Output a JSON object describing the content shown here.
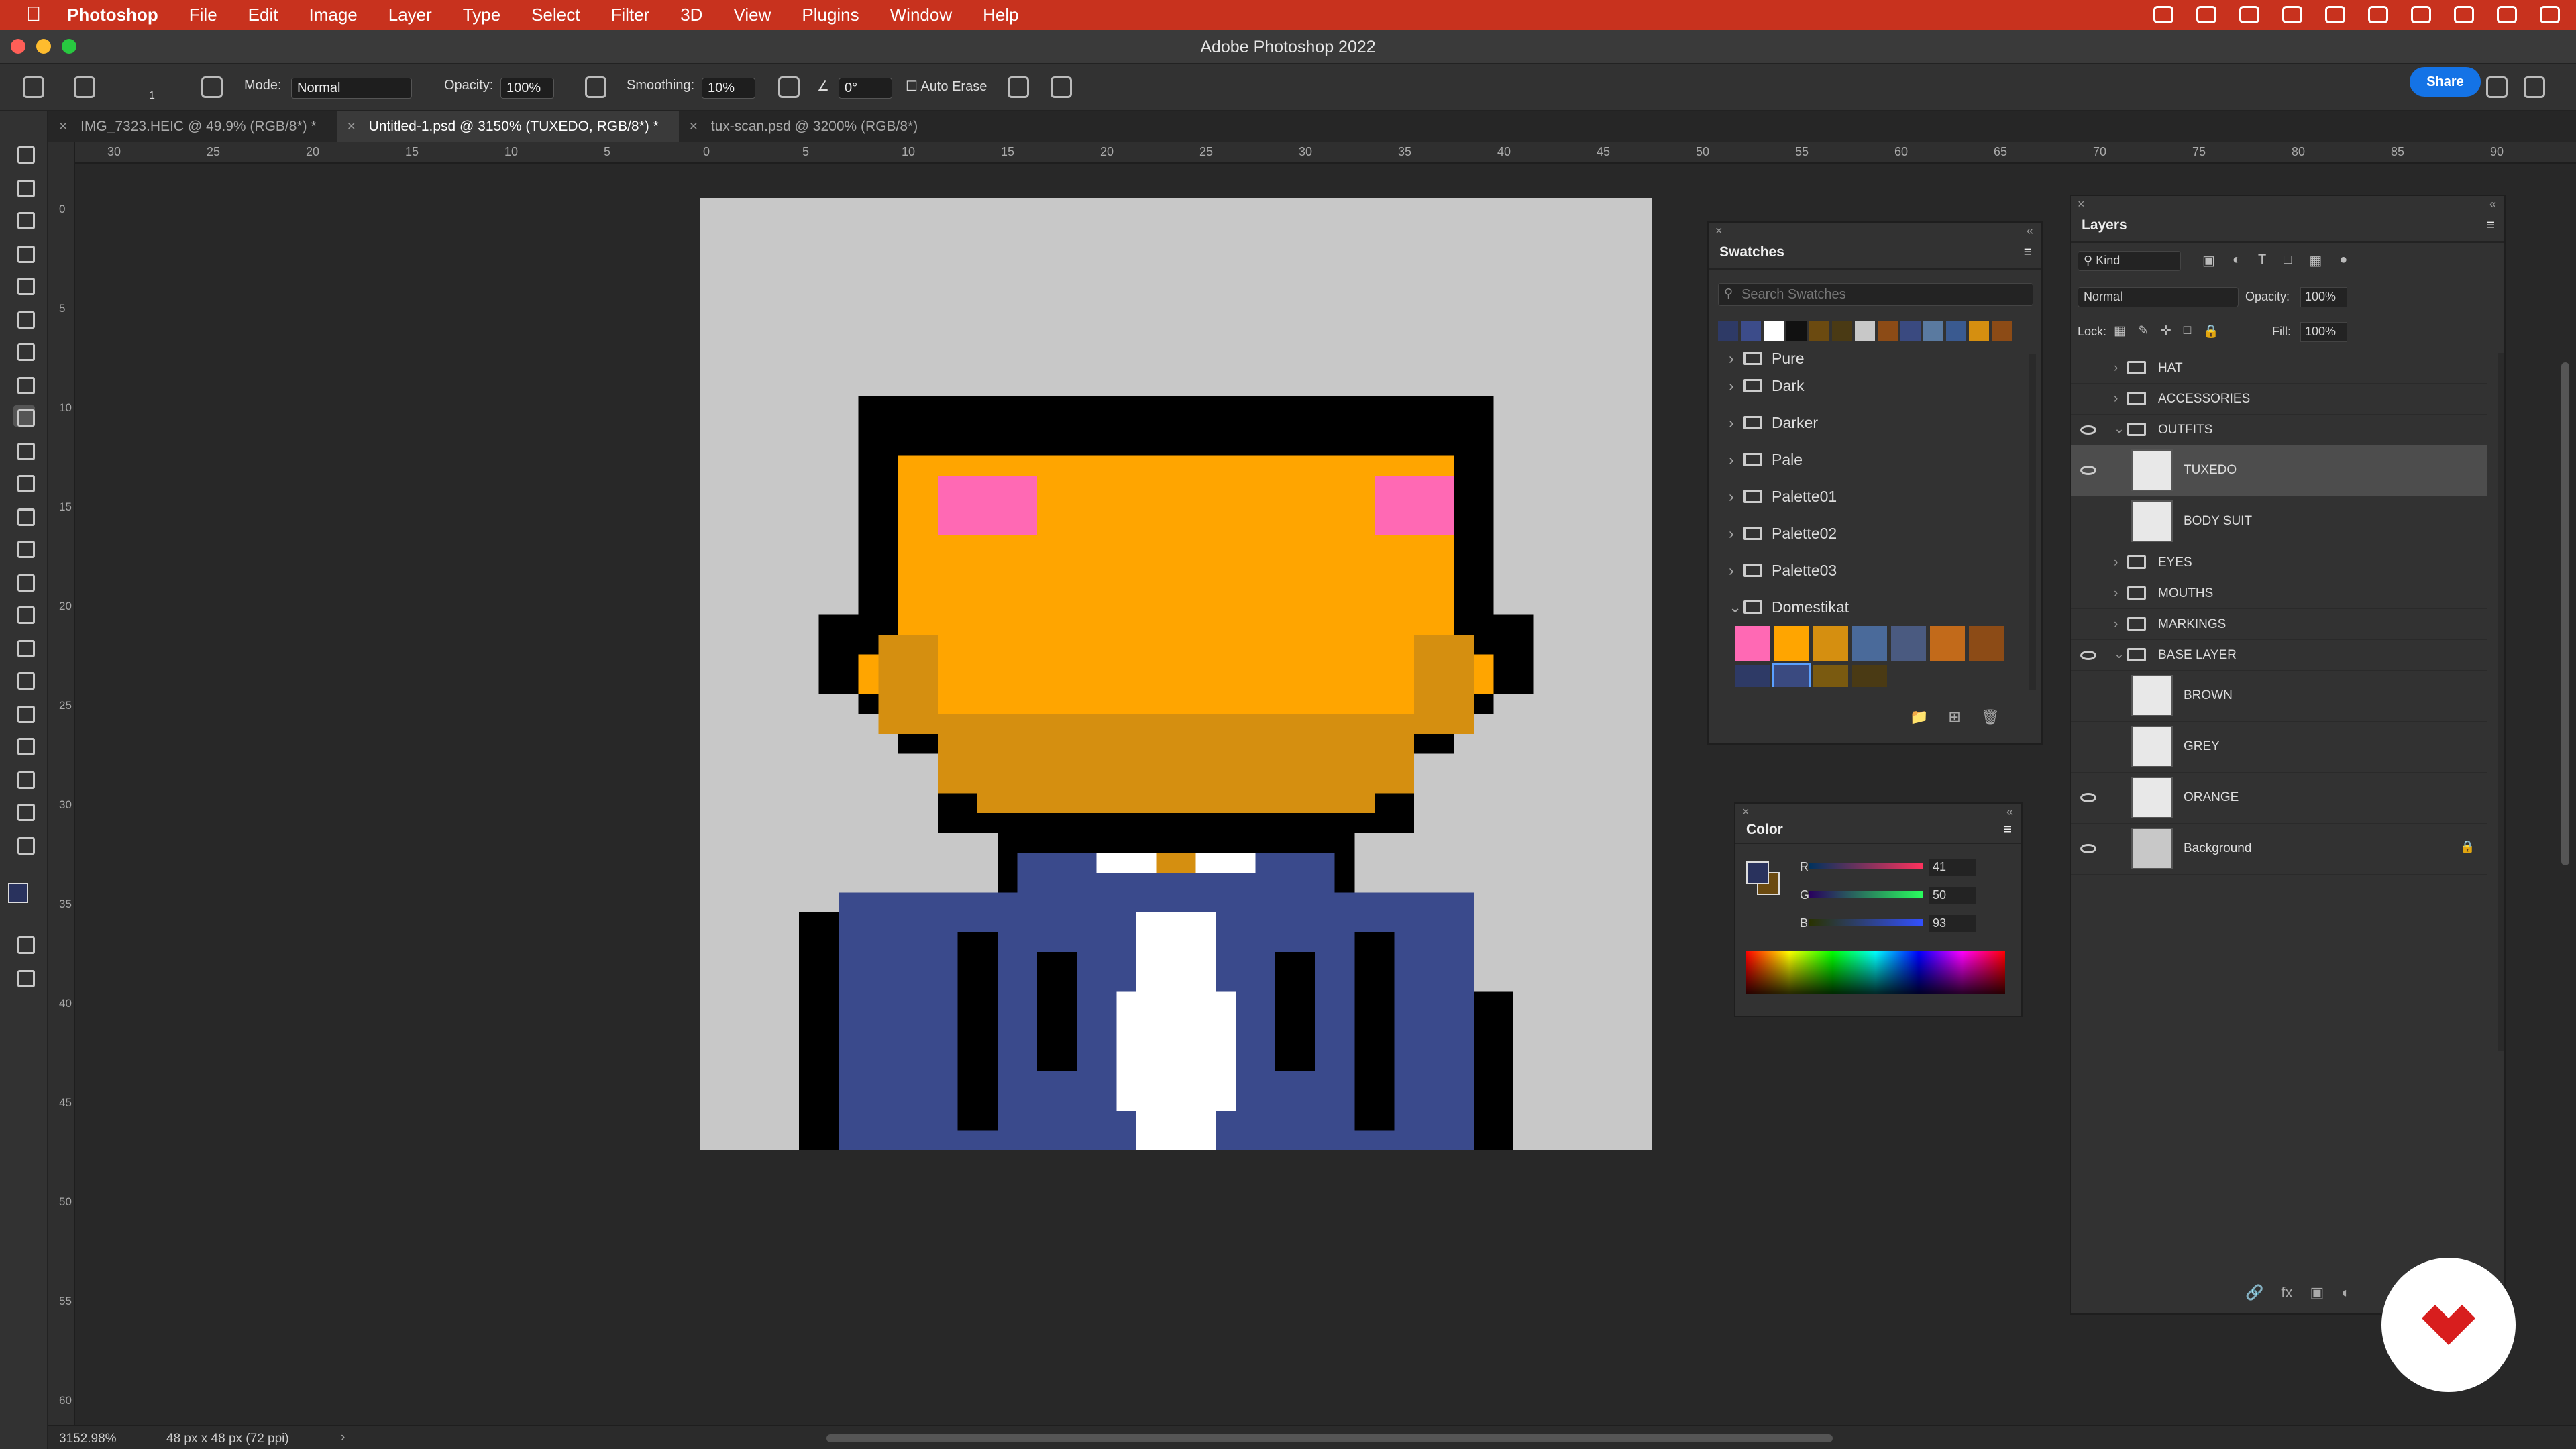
{
  "menubar": {
    "app_name": "Photoshop",
    "items": [
      "File",
      "Edit",
      "Image",
      "Layer",
      "Type",
      "Select",
      "Filter",
      "3D",
      "View",
      "Plugins",
      "Window",
      "Help"
    ],
    "accent": "#c8321e"
  },
  "window": {
    "title": "Adobe Photoshop 2022"
  },
  "options_bar": {
    "mode_label": "Mode:",
    "mode_value": "Normal",
    "opacity_label": "Opacity:",
    "opacity_value": "100%",
    "smoothing_label": "Smoothing:",
    "smoothing_value": "10%",
    "angle_value": "0°",
    "auto_erase_label": "Auto Erase",
    "brush_size": "1",
    "share_label": "Share"
  },
  "tabs": [
    {
      "label": "IMG_7323.HEIC @ 49.9% (RGB/8*) *",
      "active": false
    },
    {
      "label": "Untitled-1.psd @ 3150% (TUXEDO, RGB/8*) *",
      "active": true
    },
    {
      "label": "tux-scan.psd @ 3200% (RGB/8*)",
      "active": false
    }
  ],
  "ruler_h_ticks": [
    "30",
    "25",
    "20",
    "15",
    "10",
    "5",
    "0",
    "5",
    "10",
    "15",
    "20",
    "25",
    "30",
    "35",
    "40",
    "45",
    "50",
    "55",
    "60",
    "65",
    "70",
    "75",
    "80",
    "85",
    "90"
  ],
  "ruler_v_ticks": [
    "0",
    "5",
    "10",
    "15",
    "20",
    "25",
    "30",
    "35",
    "40",
    "45",
    "50",
    "55",
    "60"
  ],
  "swatches": {
    "title": "Swatches",
    "search_placeholder": "Search Swatches",
    "recent_colors": [
      "#2e3a66",
      "#3c4c8a",
      "#ffffff",
      "#111111",
      "#6b4a10",
      "#4a3a14",
      "#c8c8c8",
      "#8c4b16",
      "#3a4a80",
      "#5a7aa0",
      "#3a5a90",
      "#d58f10",
      "#8c4b16"
    ],
    "groups": [
      {
        "name": "Pure",
        "open": false
      },
      {
        "name": "Dark",
        "open": false
      },
      {
        "name": "Darker",
        "open": false
      },
      {
        "name": "Pale",
        "open": false
      },
      {
        "name": "Palette01",
        "open": false
      },
      {
        "name": "Palette02",
        "open": false
      },
      {
        "name": "Palette03",
        "open": false
      },
      {
        "name": "Domestikat",
        "open": true
      }
    ],
    "domestikat_colors": [
      "#ff69b4",
      "#ffa500",
      "#d58f10",
      "#4a6a9a",
      "#4a5a80",
      "#c26a1a",
      "#8c4b16",
      "#2e3a66",
      "#3a4a80",
      "#7a5a10",
      "#4a3a14"
    ]
  },
  "color_panel": {
    "title": "Color",
    "r_label": "R",
    "r_value": "41",
    "g_label": "G",
    "g_value": "50",
    "b_label": "B",
    "b_value": "93",
    "foreground": "#29325d",
    "background": "#6b4a10"
  },
  "layers": {
    "title": "Layers",
    "filter_kind": "Kind",
    "blend_mode": "Normal",
    "opacity_label": "Opacity:",
    "opacity_value": "100%",
    "lock_label": "Lock:",
    "fill_label": "Fill:",
    "fill_value": "100%",
    "items": [
      {
        "name": "HAT",
        "type": "group",
        "visible": false,
        "expanded": false,
        "indent": 0
      },
      {
        "name": "ACCESSORIES",
        "type": "group",
        "visible": false,
        "expanded": false,
        "indent": 0
      },
      {
        "name": "OUTFITS",
        "type": "group",
        "visible": true,
        "expanded": true,
        "indent": 0
      },
      {
        "name": "TUXEDO",
        "type": "layer",
        "visible": true,
        "selected": true,
        "indent": 1
      },
      {
        "name": "BODY SUIT",
        "type": "layer",
        "visible": false,
        "indent": 1
      },
      {
        "name": "EYES",
        "type": "group",
        "visible": false,
        "expanded": false,
        "indent": 0
      },
      {
        "name": "MOUTHS",
        "type": "group",
        "visible": false,
        "expanded": false,
        "indent": 0
      },
      {
        "name": "MARKINGS",
        "type": "group",
        "visible": false,
        "expanded": false,
        "indent": 0
      },
      {
        "name": "BASE LAYER",
        "type": "group",
        "visible": true,
        "expanded": true,
        "indent": 0
      },
      {
        "name": "BROWN",
        "type": "layer",
        "visible": false,
        "indent": 1
      },
      {
        "name": "GREY",
        "type": "layer",
        "visible": false,
        "indent": 1
      },
      {
        "name": "ORANGE",
        "type": "layer",
        "visible": true,
        "indent": 1
      },
      {
        "name": "Background",
        "type": "background",
        "visible": true,
        "locked": true,
        "indent": 0
      }
    ]
  },
  "status": {
    "zoom": "3152.98%",
    "doc_size": "48 px x 48 px (72 ppi)"
  },
  "artwork": {
    "orange": "#ffa500",
    "dark_orange": "#d58f10",
    "pink": "#ff69b4",
    "navy": "#3a4a8c",
    "black": "#000000",
    "white": "#ffffff",
    "canvas_bg": "#c8c8c8"
  }
}
